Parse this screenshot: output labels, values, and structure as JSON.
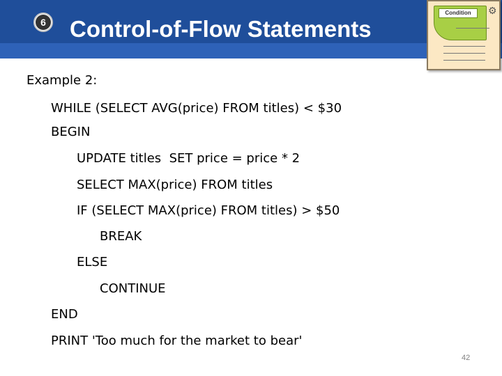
{
  "header": {
    "section_number": "6",
    "title": "Control-of-Flow Statements",
    "condition_card": {
      "label": "Condition",
      "icon": "gear-icon"
    }
  },
  "content": {
    "heading": "Example 2:",
    "code_lines": [
      "WHILE (SELECT AVG(price) FROM titles) < $30",
      "BEGIN",
      "UPDATE titles  SET price = price * 2",
      "SELECT MAX(price) FROM titles",
      "IF (SELECT MAX(price) FROM titles) > $50",
      "BREAK",
      "ELSE",
      "CONTINUE",
      "END",
      "PRINT 'Too much for the market to bear'"
    ]
  },
  "footer": {
    "page_number": "42"
  },
  "colors": {
    "title_bar": "#1f4e9a",
    "title_text": "#ffffff",
    "card_background": "#fce8c4",
    "card_green": "#a8cf45"
  }
}
